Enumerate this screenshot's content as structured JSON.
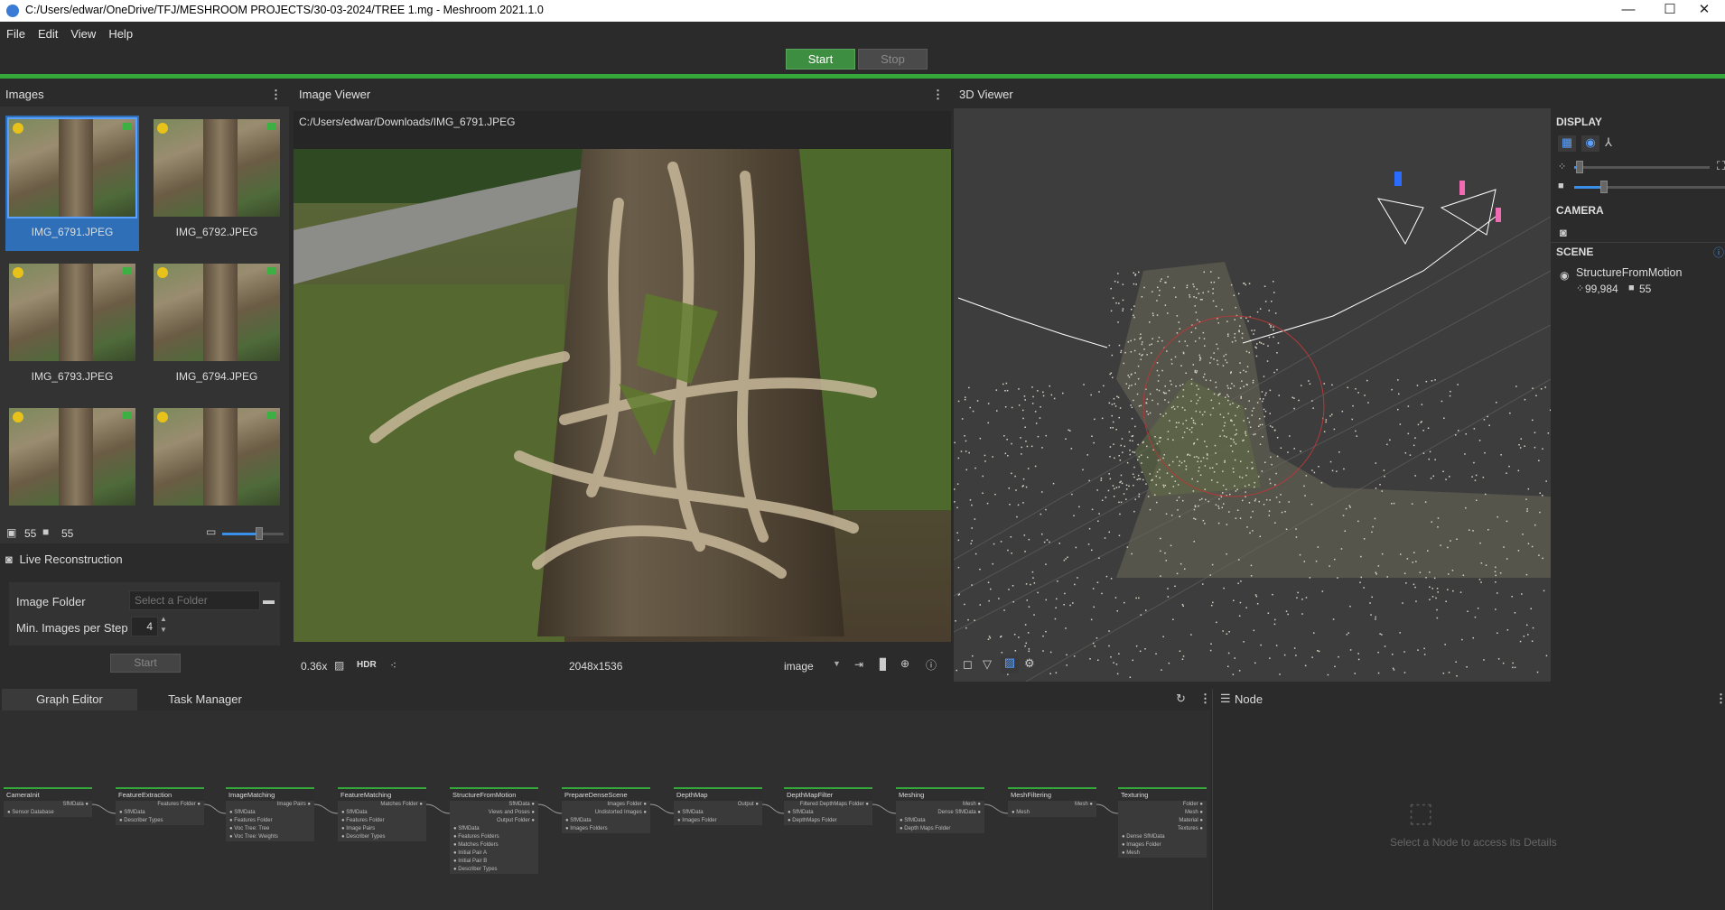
{
  "window": {
    "title": "C:/Users/edwar/OneDrive/TFJ/MESHROOM PROJECTS/30-03-2024/TREE 1.mg - Meshroom 2021.1.0",
    "controls": [
      "—",
      "☐",
      "✕"
    ]
  },
  "menu": [
    "File",
    "Edit",
    "View",
    "Help"
  ],
  "toolbar": {
    "start_label": "Start",
    "stop_label": "Stop"
  },
  "images_panel": {
    "title": "Images",
    "thumbnails": [
      {
        "label": "IMG_6791.JPEG",
        "selected": true
      },
      {
        "label": "IMG_6792.JPEG",
        "selected": false
      },
      {
        "label": "IMG_6793.JPEG",
        "selected": false
      },
      {
        "label": "IMG_6794.JPEG",
        "selected": false
      },
      {
        "label": "",
        "selected": false
      },
      {
        "label": "",
        "selected": false
      }
    ],
    "image_count": "55",
    "camera_count": "55",
    "thumbnail_size": 0.6
  },
  "live_reconstruction": {
    "title": "Live Reconstruction",
    "image_folder_label": "Image Folder",
    "image_folder_placeholder": "Select a Folder",
    "min_images_label": "Min. Images per Step",
    "min_images_value": "4",
    "start_label": "Start"
  },
  "image_viewer": {
    "title": "Image Viewer",
    "path": "C:/Users/edwar/Downloads/IMG_6791.JPEG",
    "zoom": "0.36x",
    "hdr_label": "HDR",
    "resolution": "2048x1536",
    "mode": "image"
  },
  "viewer_3d": {
    "title": "3D Viewer",
    "display_title": "DISPLAY",
    "camera_title": "CAMERA",
    "scene_title": "SCENE",
    "scene_item": "StructureFromMotion",
    "points": "99,984",
    "cameras": "55",
    "point_size": 0.04,
    "camera_scale": 0.2
  },
  "graph_editor": {
    "tabs": [
      "Graph Editor",
      "Task Manager"
    ],
    "nodes": [
      {
        "title": "CameraInit",
        "inputs": [
          "Sensor Database"
        ],
        "outputs": [
          "SfMData"
        ]
      },
      {
        "title": "FeatureExtraction",
        "inputs": [
          "SfMData",
          "Describer Types"
        ],
        "outputs": [
          "Features Folder"
        ]
      },
      {
        "title": "ImageMatching",
        "inputs": [
          "SfMData",
          "Features Folder",
          "Voc Tree: Tree",
          "Voc Tree: Weights"
        ],
        "outputs": [
          "Image Pairs"
        ]
      },
      {
        "title": "FeatureMatching",
        "inputs": [
          "SfMData",
          "Features Folder",
          "Image Pairs",
          "Describer Types"
        ],
        "outputs": [
          "Matches Folder"
        ]
      },
      {
        "title": "StructureFromMotion",
        "inputs": [
          "SfMData",
          "Features Folders",
          "Matches Folders",
          "Initial Pair A",
          "Initial Pair B",
          "Describer Types"
        ],
        "outputs": [
          "SfMData",
          "Views and Poses",
          "Output Folder"
        ]
      },
      {
        "title": "PrepareDenseScene",
        "inputs": [
          "SfMData",
          "Images Folders"
        ],
        "outputs": [
          "Images Folder",
          "Undistorted Images"
        ]
      },
      {
        "title": "DepthMap",
        "inputs": [
          "SfMData",
          "Images Folder"
        ],
        "outputs": [
          "Output"
        ]
      },
      {
        "title": "DepthMapFilter",
        "inputs": [
          "SfMData",
          "DepthMaps Folder"
        ],
        "outputs": [
          "Filtered DepthMaps Folder"
        ]
      },
      {
        "title": "Meshing",
        "inputs": [
          "SfMData",
          "Depth Maps Folder"
        ],
        "outputs": [
          "Mesh",
          "Dense SfMData"
        ]
      },
      {
        "title": "MeshFiltering",
        "inputs": [
          "Mesh"
        ],
        "outputs": [
          "Mesh"
        ]
      },
      {
        "title": "Texturing",
        "inputs": [
          "Dense SfMData",
          "Images Folder",
          "Mesh"
        ],
        "outputs": [
          "Folder",
          "Mesh",
          "Material",
          "Textures"
        ]
      }
    ]
  },
  "node_panel": {
    "title": "Node",
    "empty_message": "Select a Node to access its Details"
  }
}
